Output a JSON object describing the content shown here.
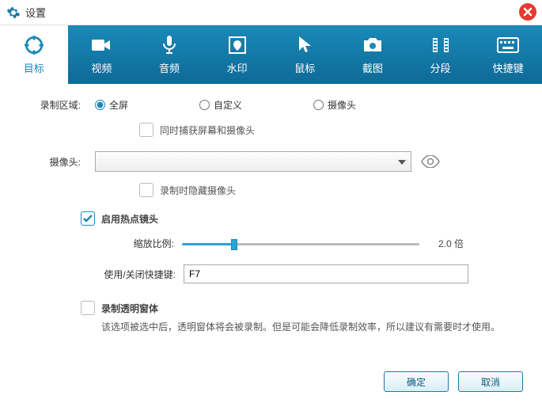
{
  "window": {
    "title": "设置"
  },
  "tabs": {
    "target": "目标",
    "video": "视频",
    "audio": "音频",
    "watermark": "水印",
    "mouse": "鼠标",
    "screenshot": "截图",
    "segment": "分段",
    "shortcut": "快捷键"
  },
  "target": {
    "record_area_label": "录制区域:",
    "fullscreen": "全屏",
    "custom": "自定义",
    "camera": "摄像头",
    "capture_both": "同时捕获屏幕和摄像头",
    "camera_label": "摄像头:",
    "camera_selected": "",
    "hide_camera": "录制时隐藏摄像头",
    "enable_zoom": "启用热点镜头",
    "zoom_ratio_label": "缩放比例:",
    "zoom_value": "2.0 倍",
    "hotkey_label": "使用/关闭快捷键:",
    "hotkey_value": "F7",
    "record_transparent": "录制透明窗体",
    "transparent_desc": "该选项被选中后，透明窗体将会被录制。但是可能会降低录制效率，所以建议有需要时才使用。"
  },
  "buttons": {
    "ok": "确定",
    "cancel": "取消"
  }
}
